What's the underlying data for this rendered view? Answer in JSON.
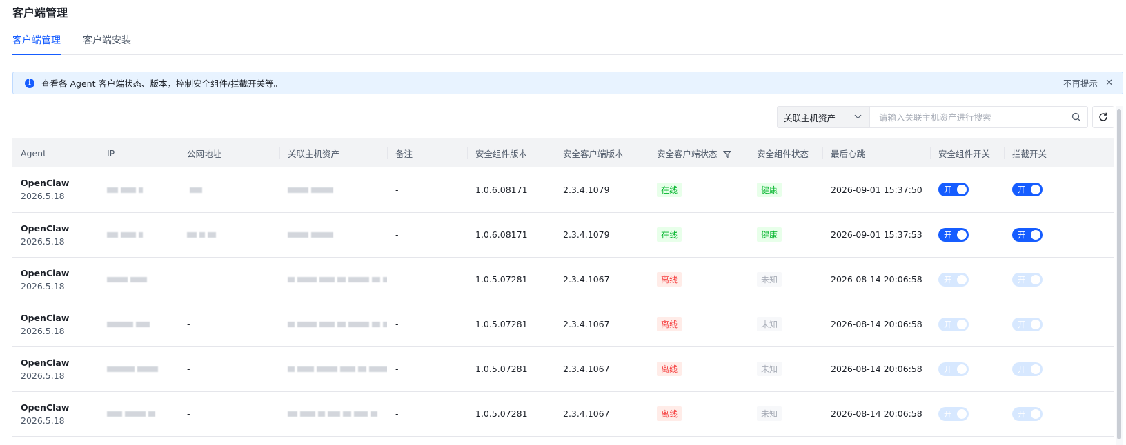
{
  "page": {
    "title": "客户端管理"
  },
  "tabs": [
    {
      "label": "客户端管理",
      "active": true
    },
    {
      "label": "客户端安装",
      "active": false
    }
  ],
  "alert": {
    "message": "查看各 Agent 客户端状态、版本，控制安全组件/拦截开关等。",
    "dismiss_label": "不再提示",
    "icon": "info-icon"
  },
  "search": {
    "field_selected": "关联主机资产",
    "placeholder": "请输入关联主机资产进行搜索"
  },
  "colors": {
    "accent": "#165dff",
    "online": "#00b42a",
    "offline": "#f53f3f",
    "unknown": "#a9aeb8"
  },
  "table": {
    "columns": [
      "Agent",
      "IP",
      "公网地址",
      "关联主机资产",
      "备注",
      "安全组件版本",
      "安全客户端版本",
      "安全客户端状态",
      "安全组件状态",
      "最后心跳",
      "安全组件开关",
      "拦截开关"
    ],
    "rows": [
      {
        "agent_name": "OpenClaw",
        "agent_version": "2026.5.18",
        "public_ip": "",
        "remark": "-",
        "component_version": "1.0.6.08171",
        "client_version": "2.3.4.1079",
        "client_status": "在线",
        "component_status": "健康",
        "last_heartbeat": "2026-09-01 15:37:50",
        "component_switch": "开",
        "intercept_switch": "开",
        "enabled": true
      },
      {
        "agent_name": "OpenClaw",
        "agent_version": "2026.5.18",
        "public_ip": "",
        "remark": "-",
        "component_version": "1.0.6.08171",
        "client_version": "2.3.4.1079",
        "client_status": "在线",
        "component_status": "健康",
        "last_heartbeat": "2026-09-01 15:37:53",
        "component_switch": "开",
        "intercept_switch": "开",
        "enabled": true
      },
      {
        "agent_name": "OpenClaw",
        "agent_version": "2026.5.18",
        "public_ip": "-",
        "remark": "-",
        "component_version": "1.0.5.07281",
        "client_version": "2.3.4.1067",
        "client_status": "离线",
        "component_status": "未知",
        "last_heartbeat": "2026-08-14 20:06:58",
        "component_switch": "开",
        "intercept_switch": "开",
        "enabled": false
      },
      {
        "agent_name": "OpenClaw",
        "agent_version": "2026.5.18",
        "public_ip": "-",
        "remark": "-",
        "component_version": "1.0.5.07281",
        "client_version": "2.3.4.1067",
        "client_status": "离线",
        "component_status": "未知",
        "last_heartbeat": "2026-08-14 20:06:58",
        "component_switch": "开",
        "intercept_switch": "开",
        "enabled": false
      },
      {
        "agent_name": "OpenClaw",
        "agent_version": "2026.5.18",
        "public_ip": "-",
        "remark": "-",
        "component_version": "1.0.5.07281",
        "client_version": "2.3.4.1067",
        "client_status": "离线",
        "component_status": "未知",
        "last_heartbeat": "2026-08-14 20:06:58",
        "component_switch": "开",
        "intercept_switch": "开",
        "enabled": false
      },
      {
        "agent_name": "OpenClaw",
        "agent_version": "2026.5.18",
        "public_ip": "-",
        "remark": "-",
        "component_version": "1.0.5.07281",
        "client_version": "2.3.4.1067",
        "client_status": "离线",
        "component_status": "未知",
        "last_heartbeat": "2026-08-14 20:06:58",
        "component_switch": "开",
        "intercept_switch": "开",
        "enabled": false
      }
    ]
  }
}
